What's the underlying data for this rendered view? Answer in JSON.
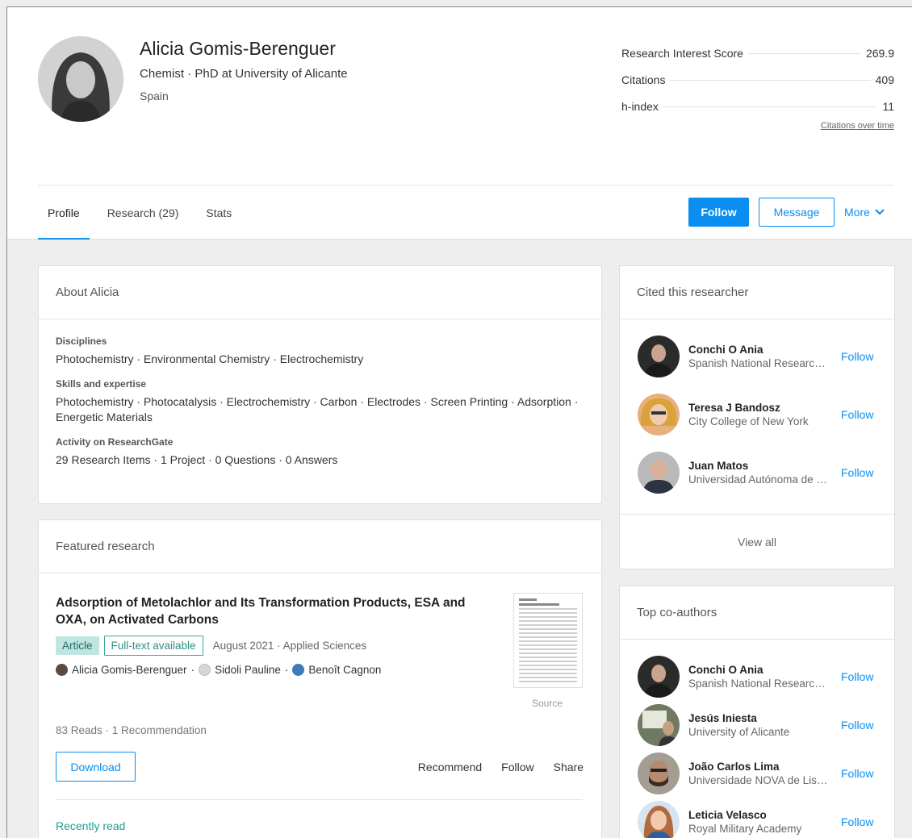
{
  "profile": {
    "name": "Alicia Gomis-Berenguer",
    "headline": "Chemist · PhD at University of Alicante",
    "location": "Spain"
  },
  "stats": [
    {
      "label": "Research Interest Score",
      "value": "269.9"
    },
    {
      "label": "Citations",
      "value": "409"
    },
    {
      "label": "h-index",
      "value": "11"
    }
  ],
  "citations_link": "Citations over time",
  "tabs": [
    {
      "label": "Profile",
      "active": true
    },
    {
      "label": "Research (29)",
      "active": false
    },
    {
      "label": "Stats",
      "active": false
    }
  ],
  "actions": {
    "follow": "Follow",
    "message": "Message",
    "more": "More"
  },
  "about": {
    "title": "About Alicia",
    "disciplines_label": "Disciplines",
    "disciplines": "Photochemistry · Environmental Chemistry · Electrochemistry",
    "skills_label": "Skills and expertise",
    "skills": "Photochemistry · Photocatalysis · Electrochemistry · Carbon · Electrodes · Screen Printing · Adsorption · Energetic Materials",
    "activity_label": "Activity on ResearchGate",
    "activity": "29 Research Items · 1 Project · 0 Questions · 0 Answers"
  },
  "featured": {
    "title": "Featured research",
    "paper_title": "Adsorption of Metolachlor and Its Transformation Products, ESA and OXA, on Activated Carbons",
    "type_badge": "Article",
    "fulltext_badge": "Full-text available",
    "meta": "August 2021 · Applied Sciences",
    "authors": [
      "Alicia Gomis-Berenguer",
      "Sidoli Pauline",
      "Benoît Cagnon"
    ],
    "author_sep": "·",
    "source": "Source",
    "reads": "83 Reads · 1 Recommendation",
    "download": "Download",
    "recommend": "Recommend",
    "follow": "Follow",
    "share": "Share",
    "recent": "Recently read"
  },
  "cited": {
    "title": "Cited this researcher",
    "people": [
      {
        "name": "Conchi O Ania",
        "affiliation": "Spanish National Research Council",
        "follow": "Follow"
      },
      {
        "name": "Teresa J Bandosz",
        "affiliation": "City College of New York",
        "follow": "Follow"
      },
      {
        "name": "Juan Matos",
        "affiliation": "Universidad Autónoma de Chile",
        "follow": "Follow"
      }
    ],
    "view_all": "View all"
  },
  "coauthors": {
    "title": "Top co-authors",
    "people": [
      {
        "name": "Conchi O Ania",
        "affiliation": "Spanish National Research Council",
        "follow": "Follow"
      },
      {
        "name": "Jesús Iniesta",
        "affiliation": "University of Alicante",
        "follow": "Follow"
      },
      {
        "name": "João Carlos Lima",
        "affiliation": "Universidade NOVA de Lisboa",
        "follow": "Follow"
      },
      {
        "name": "Leticia Velasco",
        "affiliation": "Royal Military Academy",
        "follow": "Follow"
      }
    ]
  },
  "colors": {
    "accent": "#0a8ef0",
    "teal": "#1f9e8d",
    "badge_bg": "#bfe5e1"
  }
}
